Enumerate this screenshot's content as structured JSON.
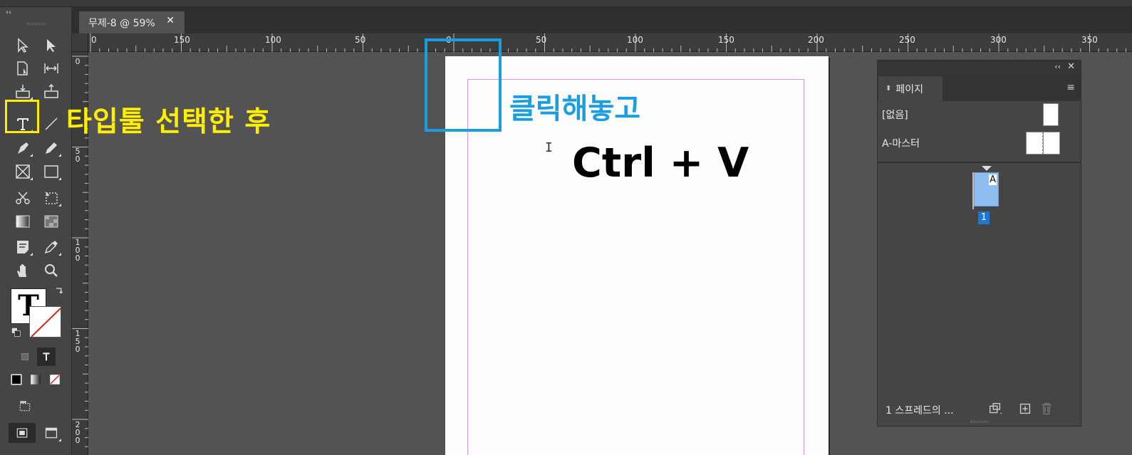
{
  "document": {
    "tab_title": "무제-8 @ 59%",
    "close_glyph": "✕"
  },
  "ruler": {
    "horizontal_labels": [
      "0",
      "150",
      "100",
      "50",
      "0",
      "50",
      "100",
      "150",
      "200",
      "250",
      "300",
      "350"
    ],
    "vertical_labels": [
      "0",
      "50",
      "100",
      "150",
      "200"
    ]
  },
  "toolbar": {
    "collapse_glyph": "‹‹",
    "tools": [
      "selection-tool",
      "direct-selection-tool",
      "page-tool",
      "gap-tool",
      "content-collector-tool",
      "content-placer-tool",
      "type-tool",
      "line-tool",
      "pen-tool",
      "pencil-tool",
      "rectangle-frame-tool",
      "rectangle-tool",
      "scissors-tool",
      "free-transform-tool",
      "gradient-swatch-tool",
      "gradient-feather-tool",
      "note-tool",
      "eyedropper-tool",
      "hand-tool",
      "zoom-tool"
    ],
    "fill_swatch_glyph": "T",
    "stroke_swatch_glyph": "T"
  },
  "annotations": {
    "select_type_tool": "타입툴 선택한 후",
    "click_first": "클릭해놓고",
    "paste_shortcut": "Ctrl + V",
    "highlight_color": "#ffee00",
    "accent_color": "#1a9ee0"
  },
  "pages_panel": {
    "title": "페이지",
    "collapse_glyph": "‹‹",
    "close_glyph": "✕",
    "masters": [
      {
        "label": "[없음]"
      },
      {
        "label": "A-마스터"
      }
    ],
    "page_thumb_master": "A",
    "page_number": "1",
    "footer_text": "1 스프레드의 ..."
  }
}
